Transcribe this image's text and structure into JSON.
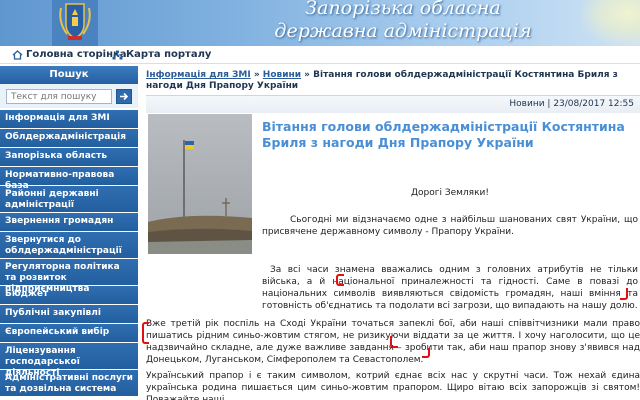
{
  "header": {
    "title_line1": "Запорізька обласна",
    "title_line2": "державна адміністрація"
  },
  "topnav": {
    "home_label": "Головна сторінка",
    "map_label": "Карта порталу",
    "home_icon": "home-icon",
    "map_icon": "sitemap-icon"
  },
  "sidebar": {
    "search_title": "Пошук",
    "search_placeholder": "Текст для пошуку",
    "search_button_icon": "arrow-right-icon",
    "items": [
      {
        "label": "Інформація для ЗМІ",
        "size": "h1"
      },
      {
        "label": "Облдержадміністрація",
        "size": "h1"
      },
      {
        "label": "Запорізька область",
        "size": "h1"
      },
      {
        "label": "Нормативно-правова база",
        "size": "h1"
      },
      {
        "label": "Районні державні адміністрації",
        "size": "h2"
      },
      {
        "label": "Звернення громадян",
        "size": "h1"
      },
      {
        "label": "Звернутися до облдержадміністрації",
        "size": "h2"
      },
      {
        "label": "Регуляторна політика та розвиток підприємництва",
        "size": "h2"
      },
      {
        "label": "Бюджет",
        "size": "h1"
      },
      {
        "label": "Публічні закупівлі",
        "size": "h1"
      },
      {
        "label": "Європейський вибір",
        "size": "h1"
      },
      {
        "label": "Ліцензування господарської діяльності",
        "size": "h2"
      },
      {
        "label": "Адміністративні послуги та дозвільна система",
        "size": "h2"
      }
    ]
  },
  "breadcrumb": {
    "link1": "Інформація для ЗМІ",
    "sep1": " » ",
    "link2": "Новини",
    "sep2": " » ",
    "current": "Вітання голови облдержадміністрації Костянтина Бриля з нагоди Дня Прапору України"
  },
  "article": {
    "rubric": "Новини | 23/08/2017 12:55",
    "title": "Вітання голови облдержадміністрації Костянтина Бриля з нагоди Дня Прапору України",
    "greeting": "Дорогі Земляки!",
    "p1": "Сьогодні ми відзначаємо одне з найбільш шанованих свят України, що присвячене державному символу - Прапору України.",
    "p2": "За всі часи знамена вважались одним з головних атрибутів не тільки війська, а й національної приналежності та гідності. Саме в повазі до національних символів виявляються свідомість громадян, наші вміння та готовність об'єднатись та подолати всі загрози, що випадають на нашу долю.",
    "p3": "Вже третій рік поспіль на Сході України точаться запеклі бої, аби наші співвітчизники мали право пишатись рідним синьо-жовтим стягом, не ризикуючи віддати за це життя. І хочу наголосити, що це надзвичайно складне, але дуже важливе завдання – зробити так, аби наш прапор знову з'явився над Донецьком, Луганськом, Сімферополем та Севастополем.",
    "p4": "Український прапор і є таким символом, котрий єднає всіх нас у скрутні часи. Тож нехай єдина українська родина пишається цим синьо-жовтим прапором. Щиро вітаю всіх запорожців зі святом! Поважайте наші",
    "p5": ""
  },
  "colors": {
    "accent": "#2f6eb1",
    "title_blue": "#4a8fd6",
    "highlight": "#e01010"
  }
}
